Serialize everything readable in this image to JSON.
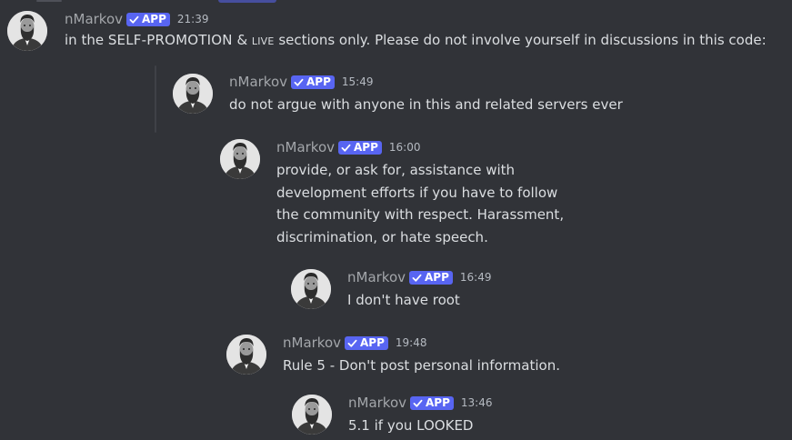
{
  "messages": [
    {
      "username": "nMarkov",
      "badge": "APP",
      "time": "21:39",
      "text_parts": [
        "in the ",
        "SELF-PROMOTION",
        " & ",
        "live",
        " sections only. Please do not involve yourself in discussions in this code:"
      ]
    },
    {
      "username": "nMarkov",
      "badge": "APP",
      "time": "15:49",
      "text": "do not argue with anyone in this and related servers ever"
    },
    {
      "username": "nMarkov",
      "badge": "APP",
      "time": "16:00",
      "lines": [
        "provide, or ask for, assistance with",
        "development efforts if you have to follow",
        "the community with respect. Harassment,",
        "discrimination, or hate speech."
      ]
    },
    {
      "username": "nMarkov",
      "badge": "APP",
      "time": "16:49",
      "text": "I don't have root"
    },
    {
      "username": "nMarkov",
      "badge": "APP",
      "time": "19:48",
      "text": "Rule 5 - Don't post personal information."
    },
    {
      "username": "nMarkov",
      "badge": "APP",
      "time": "13:46",
      "text": "5.1 if you LOOKED"
    }
  ],
  "colors": {
    "background": "#313338",
    "badge": "#5865f2",
    "username": "#a3a6aa",
    "text": "#dbdee1",
    "timestamp": "#b5bac1"
  },
  "icons": {
    "avatar": "bearded-man-portrait-avatar",
    "badge_check": "checkmark-icon"
  }
}
